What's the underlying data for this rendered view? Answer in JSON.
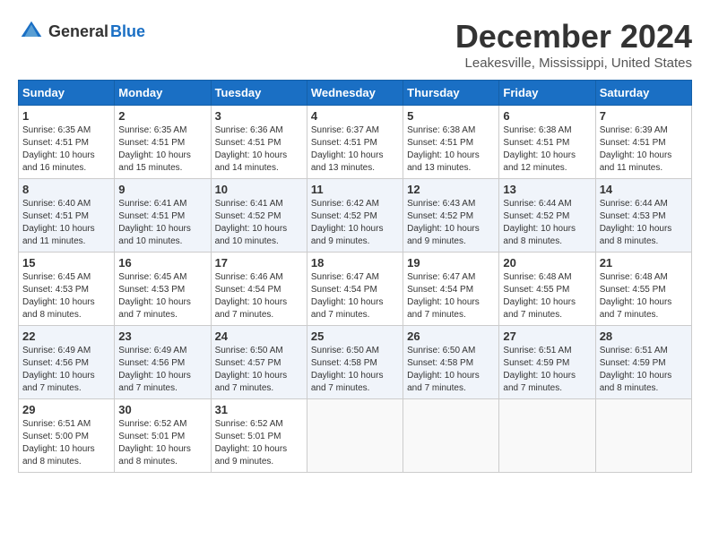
{
  "header": {
    "logo_general": "General",
    "logo_blue": "Blue",
    "month": "December 2024",
    "location": "Leakesville, Mississippi, United States"
  },
  "days_of_week": [
    "Sunday",
    "Monday",
    "Tuesday",
    "Wednesday",
    "Thursday",
    "Friday",
    "Saturday"
  ],
  "weeks": [
    [
      {
        "day": 1,
        "sunrise": "6:35 AM",
        "sunset": "4:51 PM",
        "daylight": "10 hours and 16 minutes."
      },
      {
        "day": 2,
        "sunrise": "6:35 AM",
        "sunset": "4:51 PM",
        "daylight": "10 hours and 15 minutes."
      },
      {
        "day": 3,
        "sunrise": "6:36 AM",
        "sunset": "4:51 PM",
        "daylight": "10 hours and 14 minutes."
      },
      {
        "day": 4,
        "sunrise": "6:37 AM",
        "sunset": "4:51 PM",
        "daylight": "10 hours and 13 minutes."
      },
      {
        "day": 5,
        "sunrise": "6:38 AM",
        "sunset": "4:51 PM",
        "daylight": "10 hours and 13 minutes."
      },
      {
        "day": 6,
        "sunrise": "6:38 AM",
        "sunset": "4:51 PM",
        "daylight": "10 hours and 12 minutes."
      },
      {
        "day": 7,
        "sunrise": "6:39 AM",
        "sunset": "4:51 PM",
        "daylight": "10 hours and 11 minutes."
      }
    ],
    [
      {
        "day": 8,
        "sunrise": "6:40 AM",
        "sunset": "4:51 PM",
        "daylight": "10 hours and 11 minutes."
      },
      {
        "day": 9,
        "sunrise": "6:41 AM",
        "sunset": "4:51 PM",
        "daylight": "10 hours and 10 minutes."
      },
      {
        "day": 10,
        "sunrise": "6:41 AM",
        "sunset": "4:52 PM",
        "daylight": "10 hours and 10 minutes."
      },
      {
        "day": 11,
        "sunrise": "6:42 AM",
        "sunset": "4:52 PM",
        "daylight": "10 hours and 9 minutes."
      },
      {
        "day": 12,
        "sunrise": "6:43 AM",
        "sunset": "4:52 PM",
        "daylight": "10 hours and 9 minutes."
      },
      {
        "day": 13,
        "sunrise": "6:44 AM",
        "sunset": "4:52 PM",
        "daylight": "10 hours and 8 minutes."
      },
      {
        "day": 14,
        "sunrise": "6:44 AM",
        "sunset": "4:53 PM",
        "daylight": "10 hours and 8 minutes."
      }
    ],
    [
      {
        "day": 15,
        "sunrise": "6:45 AM",
        "sunset": "4:53 PM",
        "daylight": "10 hours and 8 minutes."
      },
      {
        "day": 16,
        "sunrise": "6:45 AM",
        "sunset": "4:53 PM",
        "daylight": "10 hours and 7 minutes."
      },
      {
        "day": 17,
        "sunrise": "6:46 AM",
        "sunset": "4:54 PM",
        "daylight": "10 hours and 7 minutes."
      },
      {
        "day": 18,
        "sunrise": "6:47 AM",
        "sunset": "4:54 PM",
        "daylight": "10 hours and 7 minutes."
      },
      {
        "day": 19,
        "sunrise": "6:47 AM",
        "sunset": "4:54 PM",
        "daylight": "10 hours and 7 minutes."
      },
      {
        "day": 20,
        "sunrise": "6:48 AM",
        "sunset": "4:55 PM",
        "daylight": "10 hours and 7 minutes."
      },
      {
        "day": 21,
        "sunrise": "6:48 AM",
        "sunset": "4:55 PM",
        "daylight": "10 hours and 7 minutes."
      }
    ],
    [
      {
        "day": 22,
        "sunrise": "6:49 AM",
        "sunset": "4:56 PM",
        "daylight": "10 hours and 7 minutes."
      },
      {
        "day": 23,
        "sunrise": "6:49 AM",
        "sunset": "4:56 PM",
        "daylight": "10 hours and 7 minutes."
      },
      {
        "day": 24,
        "sunrise": "6:50 AM",
        "sunset": "4:57 PM",
        "daylight": "10 hours and 7 minutes."
      },
      {
        "day": 25,
        "sunrise": "6:50 AM",
        "sunset": "4:58 PM",
        "daylight": "10 hours and 7 minutes."
      },
      {
        "day": 26,
        "sunrise": "6:50 AM",
        "sunset": "4:58 PM",
        "daylight": "10 hours and 7 minutes."
      },
      {
        "day": 27,
        "sunrise": "6:51 AM",
        "sunset": "4:59 PM",
        "daylight": "10 hours and 7 minutes."
      },
      {
        "day": 28,
        "sunrise": "6:51 AM",
        "sunset": "4:59 PM",
        "daylight": "10 hours and 8 minutes."
      }
    ],
    [
      {
        "day": 29,
        "sunrise": "6:51 AM",
        "sunset": "5:00 PM",
        "daylight": "10 hours and 8 minutes."
      },
      {
        "day": 30,
        "sunrise": "6:52 AM",
        "sunset": "5:01 PM",
        "daylight": "10 hours and 8 minutes."
      },
      {
        "day": 31,
        "sunrise": "6:52 AM",
        "sunset": "5:01 PM",
        "daylight": "10 hours and 9 minutes."
      },
      null,
      null,
      null,
      null
    ]
  ]
}
